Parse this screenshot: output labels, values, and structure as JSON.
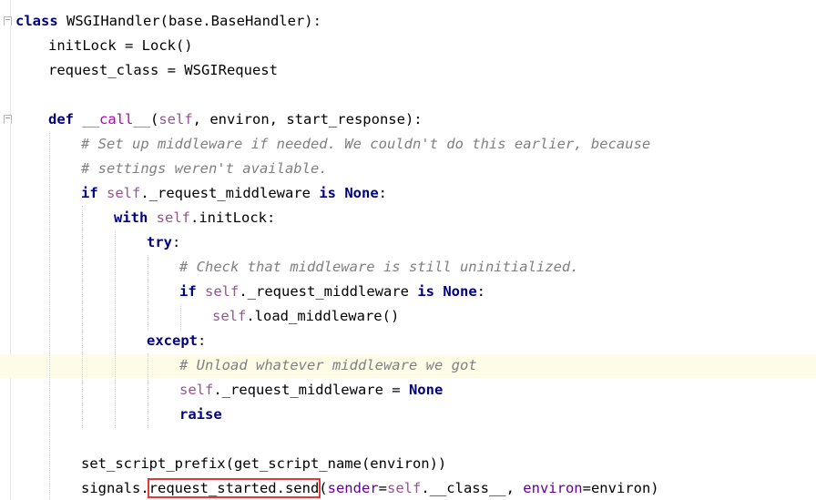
{
  "editor": {
    "lines": {
      "l1": {
        "kw": "class",
        "text": " WSGIHandler(base.BaseHandler):"
      },
      "l2": {
        "text": "initLock = Lock()"
      },
      "l3": {
        "text": "request_class = WSGIRequest"
      },
      "l5": {
        "kw": "def",
        "sp": " ",
        "magic": "__call__",
        "open": "(",
        "self": "self",
        "rest": ", environ, start_response):"
      },
      "l6": {
        "comment": "# Set up middleware if needed. We couldn't do this earlier, because"
      },
      "l7": {
        "comment": "# settings weren't available."
      },
      "l8": {
        "kw": "if",
        "self": "self",
        "mid": "._request_middleware ",
        "kw2": "is",
        "kw3": "None",
        "end": ":"
      },
      "l9": {
        "kw": "with",
        "self": "self",
        "rest": ".initLock:"
      },
      "l10": {
        "kw": "try",
        "end": ":"
      },
      "l11": {
        "comment": "# Check that middleware is still uninitialized."
      },
      "l12": {
        "kw": "if",
        "self": "self",
        "mid": "._request_middleware ",
        "kw2": "is",
        "kw3": "None",
        "end": ":"
      },
      "l13": {
        "self": "self",
        "rest": ".load_middleware()"
      },
      "l14": {
        "kw": "except",
        "end": ":"
      },
      "l15": {
        "comment": "# Unload whatever middleware we got"
      },
      "l16": {
        "self": "self",
        "mid": "._request_middleware = ",
        "kw": "None"
      },
      "l17": {
        "kw": "raise"
      },
      "l19": {
        "text": "set_script_prefix(get_script_name(environ))"
      },
      "l20": {
        "pre": "signals.",
        "boxed": "request_started.send",
        "open": "(",
        "param1": "sender",
        "eq1": "=",
        "self": "self",
        "mid": ".__class__, ",
        "param2": "environ",
        "eq2": "=",
        "end": "environ)"
      }
    },
    "colors": {
      "keyword": "#000080",
      "self": "#94558d",
      "comment": "#808080",
      "magic": "#b200b2",
      "param": "#660099",
      "highlight_box": "#e03a3a",
      "current_line": "#fefbe6"
    }
  }
}
